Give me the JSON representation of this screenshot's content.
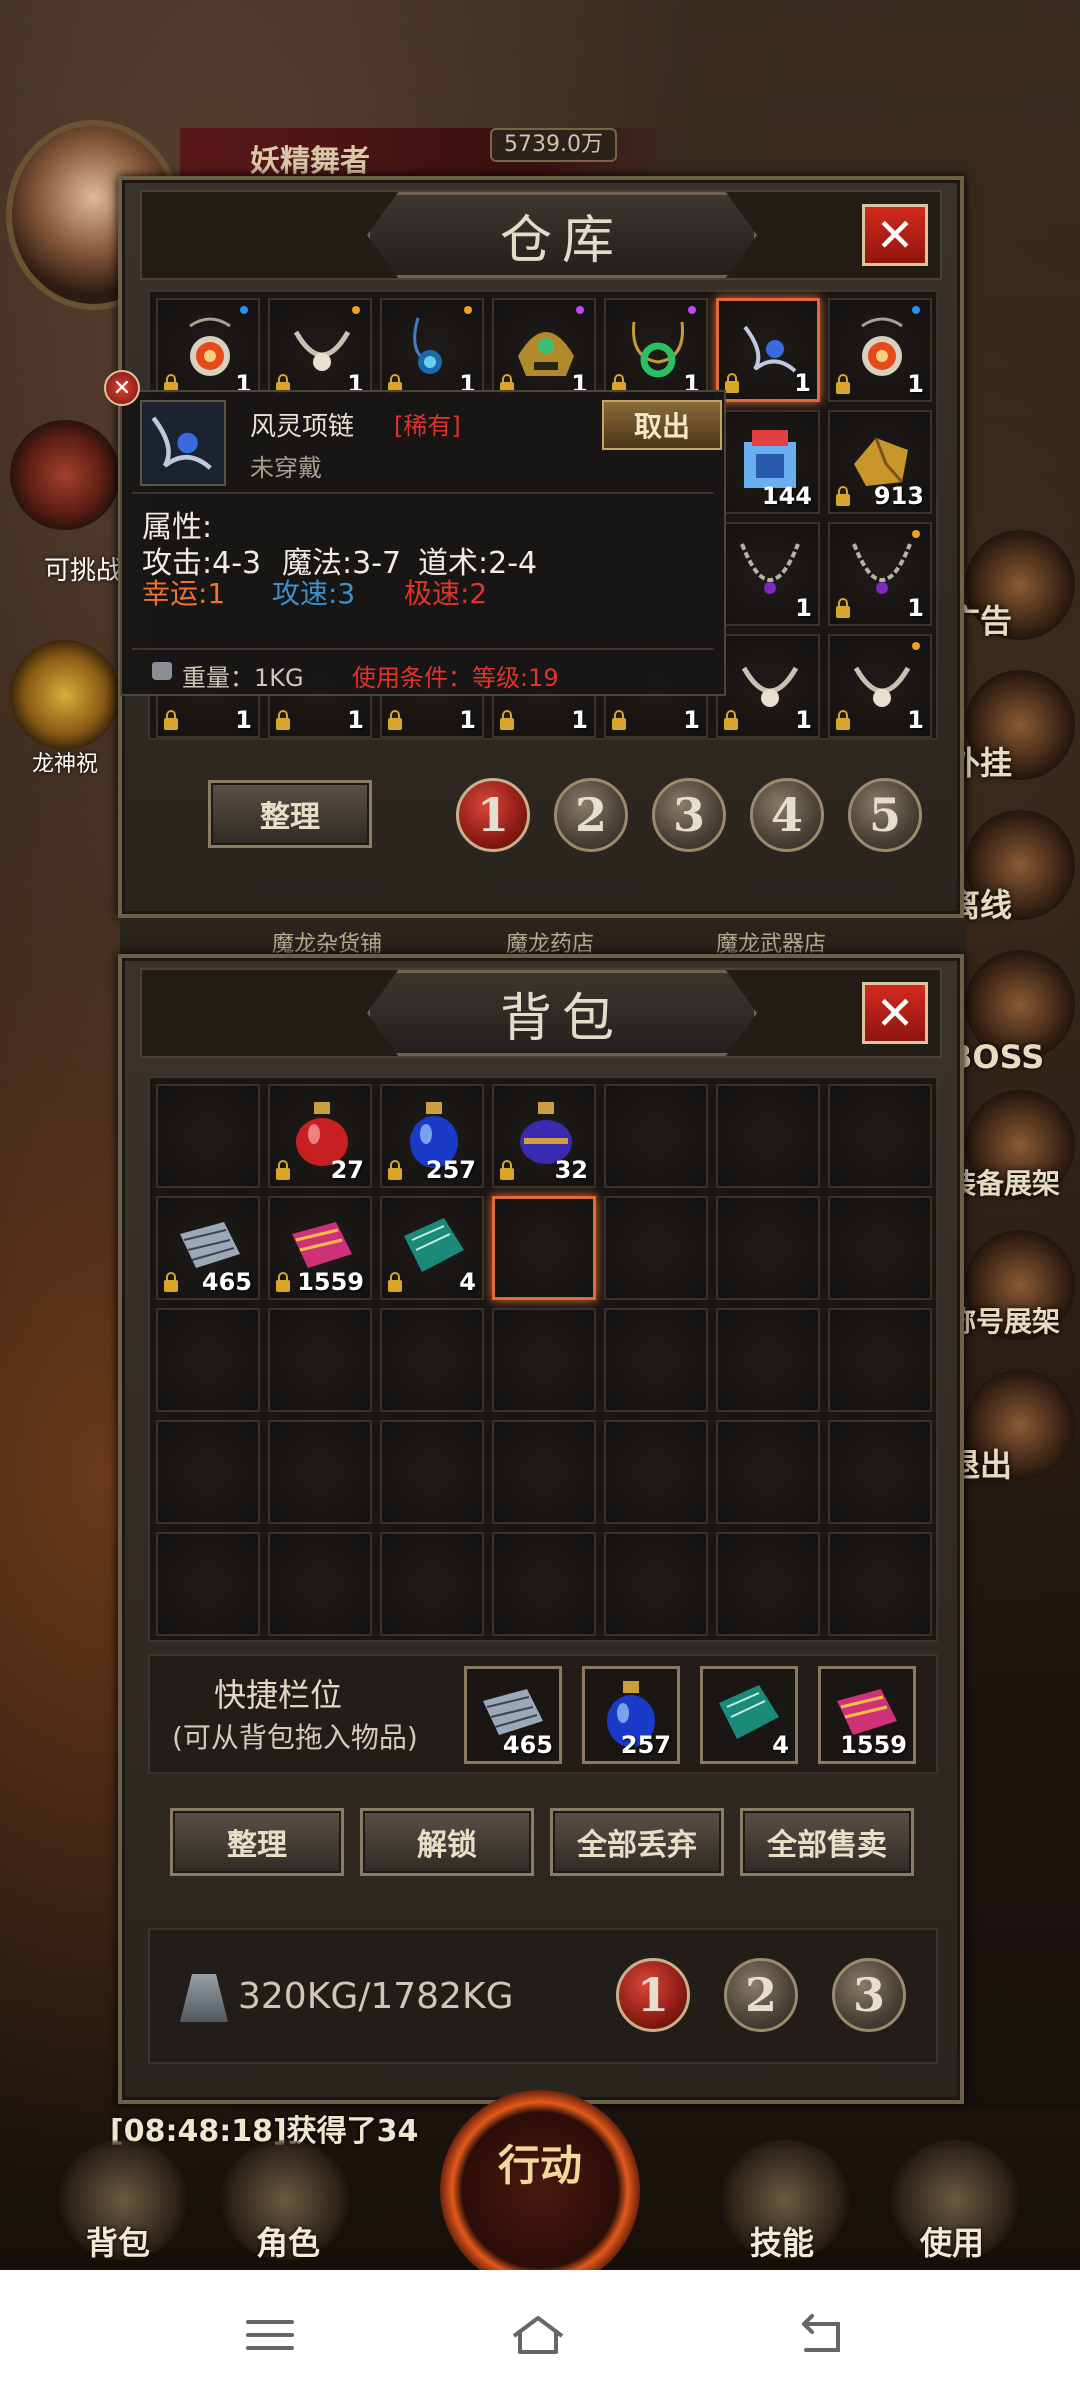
{
  "player": {
    "name": "妖精舞者",
    "gold": "5739.0万"
  },
  "left_menu": [
    {
      "label": "可挑战"
    },
    {
      "label": "龙神祝"
    }
  ],
  "right_menu": [
    "广告",
    "外挂",
    "离线",
    "BOSS",
    "装备展架",
    "称号展架",
    "退出"
  ],
  "warehouse": {
    "title": "仓库",
    "close_label": "✕",
    "slots": [
      {
        "qty": "1",
        "icon": "eye-amulet-icon",
        "locked": true
      },
      {
        "qty": "1",
        "icon": "bone-necklace-icon",
        "locked": true
      },
      {
        "qty": "1",
        "icon": "blue-gem-necklace-icon",
        "locked": true
      },
      {
        "qty": "1",
        "icon": "gold-helmet-icon",
        "locked": true
      },
      {
        "qty": "1",
        "icon": "jade-necklace-icon",
        "locked": true
      },
      {
        "qty": "1",
        "icon": "wind-necklace-icon",
        "locked": true
      },
      {
        "qty": "1",
        "icon": "eye-amulet-icon",
        "locked": true
      },
      {
        "qty": "144",
        "icon": "potion-box-icon",
        "locked": false
      },
      {
        "qty": "913",
        "icon": "gold-ore-icon",
        "locked": true
      },
      {
        "qty": "1",
        "icon": "chain-necklace-icon",
        "locked": false
      },
      {
        "qty": "1",
        "icon": "chain-necklace-icon",
        "locked": true
      },
      {
        "qty": "1",
        "icon": "bone-necklace-icon",
        "locked": true
      },
      {
        "qty": "1",
        "icon": "bone-necklace-icon",
        "locked": true
      }
    ],
    "bottom_row_qty": [
      "1",
      "1",
      "1",
      "1",
      "1",
      "1",
      "1"
    ],
    "sort_label": "整理",
    "pages": [
      "1",
      "2",
      "3",
      "4",
      "5"
    ],
    "active_page": "1"
  },
  "tooltip": {
    "name": "风灵项链",
    "rarity": "[稀有]",
    "status": "未穿戴",
    "take_out_label": "取出",
    "attr_header": "属性:",
    "attack": "攻击:4-3",
    "magic": "魔法:3-7",
    "taoism": "道术:2-4",
    "luck": "幸运:1",
    "attack_speed": "攻速:3",
    "extreme_speed": "极速:2",
    "weight": "重量：1KG",
    "requirement": "使用条件：等级:19"
  },
  "shop_tabs": [
    "魔龙杂货铺",
    "魔龙药店",
    "魔龙武器店"
  ],
  "backpack": {
    "title": "背包",
    "close_label": "✕",
    "items": [
      {
        "qty": "27",
        "icon": "red-potion-icon"
      },
      {
        "qty": "257",
        "icon": "blue-potion-icon"
      },
      {
        "qty": "32",
        "icon": "purple-potion-icon"
      },
      {
        "qty": "465",
        "icon": "silver-scroll-icon"
      },
      {
        "qty": "1559",
        "icon": "pink-scroll-icon"
      },
      {
        "qty": "4",
        "icon": "green-book-icon"
      }
    ],
    "quickbar_title": "快捷栏位",
    "quickbar_hint": "(可从背包拖入物品)",
    "quickbar": [
      {
        "qty": "465",
        "icon": "silver-scroll-icon"
      },
      {
        "qty": "257",
        "icon": "blue-potion-icon"
      },
      {
        "qty": "4",
        "icon": "green-book-icon"
      },
      {
        "qty": "1559",
        "icon": "pink-scroll-icon"
      }
    ],
    "buttons": [
      "整理",
      "解锁",
      "全部丢弃",
      "全部售卖"
    ],
    "weight": "320KG/1782KG",
    "pages": [
      "1",
      "2",
      "3"
    ],
    "active_page": "1"
  },
  "chat_line": "[08:48:18]获得了34",
  "bottom_nav": [
    "背包",
    "角色",
    "行动",
    "技能",
    "使用"
  ]
}
